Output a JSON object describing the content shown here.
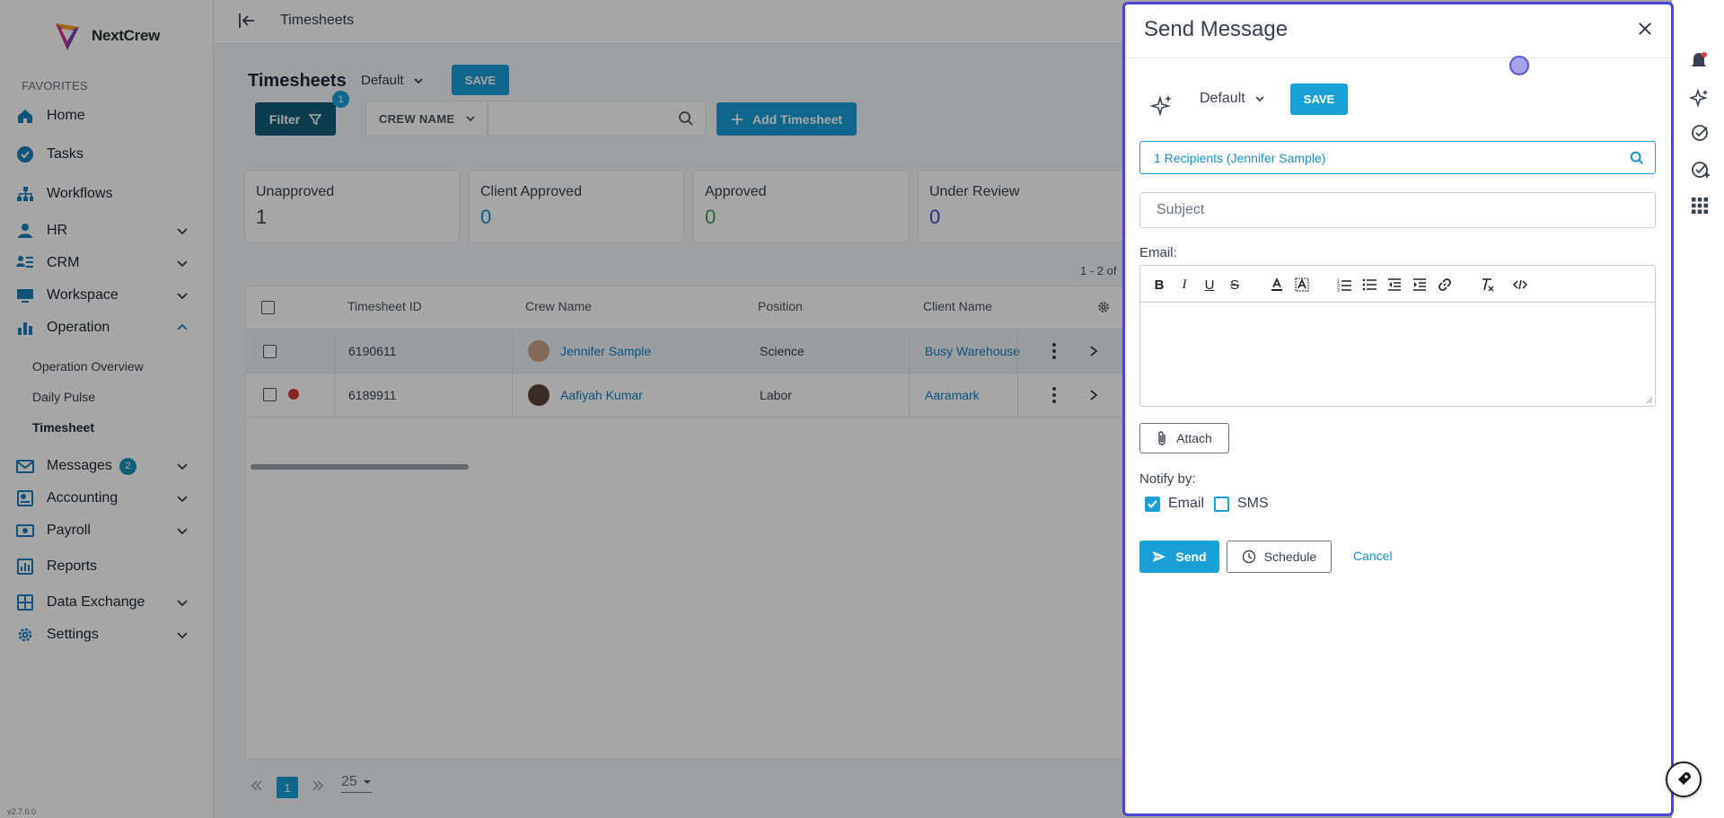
{
  "app": {
    "name": "NextCrew",
    "version": "v2.7.0.0"
  },
  "sidebar": {
    "favorites_label": "FAVORITES",
    "items": [
      {
        "label": "Home",
        "icon": "home-icon"
      },
      {
        "label": "Tasks",
        "icon": "check-circle-icon"
      },
      {
        "label": "Workflows",
        "icon": "workflow-icon"
      },
      {
        "label": "HR",
        "icon": "person-icon"
      },
      {
        "label": "CRM",
        "icon": "crm-icon"
      },
      {
        "label": "Workspace",
        "icon": "monitor-icon"
      },
      {
        "label": "Operation",
        "icon": "chart-bar-icon"
      },
      {
        "label": "Messages",
        "icon": "mail-icon",
        "badge": "2"
      },
      {
        "label": "Accounting",
        "icon": "accounting-icon"
      },
      {
        "label": "Payroll",
        "icon": "payroll-icon"
      },
      {
        "label": "Reports",
        "icon": "reports-icon"
      },
      {
        "label": "Data Exchange",
        "icon": "grid-icon"
      },
      {
        "label": "Settings",
        "icon": "gear-icon"
      }
    ],
    "operation_sub": [
      "Operation Overview",
      "Daily Pulse",
      "Timesheet"
    ]
  },
  "topbar": {
    "title": "Timesheets"
  },
  "main": {
    "title": "Timesheets",
    "view": "Default",
    "save_label": "SAVE",
    "filter_label": "Filter",
    "filter_count": "1",
    "crew_dropdown": "CREW NAME",
    "add_label": "Add Timesheet",
    "cards": [
      {
        "label": "Unapproved",
        "value": "1",
        "color": "#374151"
      },
      {
        "label": "Client Approved",
        "value": "0",
        "color": "#1a8fc8"
      },
      {
        "label": "Approved",
        "value": "0",
        "color": "#3ea04a"
      },
      {
        "label": "Under Review",
        "value": "0",
        "color": "#4b45d6"
      }
    ],
    "pager_info": "1 - 2 of",
    "columns": [
      "Timesheet ID",
      "Crew Name",
      "Position",
      "Client Name"
    ],
    "rows": [
      {
        "id": "6190611",
        "crew": "Jennifer Sample",
        "position": "Science",
        "client": "Busy Warehouse"
      },
      {
        "id": "6189911",
        "crew": "Aafiyah Kumar",
        "position": "Labor",
        "client": "Aaramark"
      }
    ],
    "page": "1",
    "page_size": "25"
  },
  "modal": {
    "title": "Send Message",
    "view": "Default",
    "save_label": "SAVE",
    "recipients": "1 Recipients (Jennifer Sample)",
    "subject_placeholder": "Subject",
    "email_label": "Email:",
    "attach_label": "Attach",
    "notify_label": "Notify by:",
    "notify_email": "Email",
    "notify_sms": "SMS",
    "notify_email_checked": true,
    "notify_sms_checked": false,
    "send_label": "Send",
    "schedule_label": "Schedule",
    "cancel_label": "Cancel"
  },
  "colors": {
    "accent": "#1a9fd6",
    "modal_border": "#4b45d6",
    "filter_bg": "#145c79"
  }
}
